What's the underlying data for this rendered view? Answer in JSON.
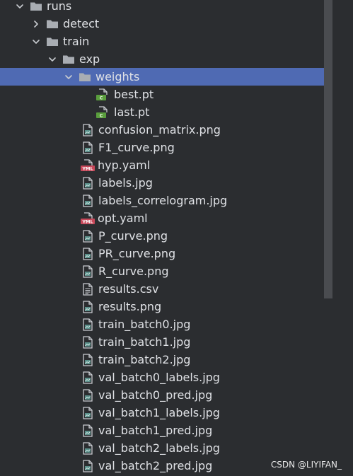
{
  "tree": [
    {
      "label": "runs",
      "type": "folder",
      "depth": 0,
      "expanded": true
    },
    {
      "label": "detect",
      "type": "folder",
      "depth": 1,
      "expanded": false
    },
    {
      "label": "train",
      "type": "folder",
      "depth": 1,
      "expanded": true
    },
    {
      "label": "exp",
      "type": "folder",
      "depth": 2,
      "expanded": true
    },
    {
      "label": "weights",
      "type": "folder",
      "depth": 3,
      "expanded": true,
      "selected": true
    },
    {
      "label": "best.pt",
      "type": "pt",
      "depth": 4
    },
    {
      "label": "last.pt",
      "type": "pt",
      "depth": 4
    },
    {
      "label": "confusion_matrix.png",
      "type": "image",
      "depth": 3
    },
    {
      "label": "F1_curve.png",
      "type": "image",
      "depth": 3
    },
    {
      "label": "hyp.yaml",
      "type": "yaml",
      "depth": 3
    },
    {
      "label": "labels.jpg",
      "type": "image",
      "depth": 3
    },
    {
      "label": "labels_correlogram.jpg",
      "type": "image",
      "depth": 3
    },
    {
      "label": "opt.yaml",
      "type": "yaml",
      "depth": 3
    },
    {
      "label": "P_curve.png",
      "type": "image",
      "depth": 3
    },
    {
      "label": "PR_curve.png",
      "type": "image",
      "depth": 3
    },
    {
      "label": "R_curve.png",
      "type": "image",
      "depth": 3
    },
    {
      "label": "results.csv",
      "type": "text",
      "depth": 3
    },
    {
      "label": "results.png",
      "type": "image",
      "depth": 3
    },
    {
      "label": "train_batch0.jpg",
      "type": "image",
      "depth": 3
    },
    {
      "label": "train_batch1.jpg",
      "type": "image",
      "depth": 3
    },
    {
      "label": "train_batch2.jpg",
      "type": "image",
      "depth": 3
    },
    {
      "label": "val_batch0_labels.jpg",
      "type": "image",
      "depth": 3
    },
    {
      "label": "val_batch0_pred.jpg",
      "type": "image",
      "depth": 3
    },
    {
      "label": "val_batch1_labels.jpg",
      "type": "image",
      "depth": 3
    },
    {
      "label": "val_batch1_pred.jpg",
      "type": "image",
      "depth": 3
    },
    {
      "label": "val_batch2_labels.jpg",
      "type": "image",
      "depth": 3
    },
    {
      "label": "val_batch2_pred.jpg",
      "type": "image",
      "depth": 3
    }
  ],
  "watermark": "CSDN @LIYIFAN_",
  "colors": {
    "background": "#2b2d30",
    "selection": "#4f6ab3",
    "text": "#dfe1e5",
    "folder": "#a9adb3",
    "image_file": "#5a8f8a",
    "pt_file": "#5a9e3d",
    "yaml_badge": "#c8485a"
  }
}
